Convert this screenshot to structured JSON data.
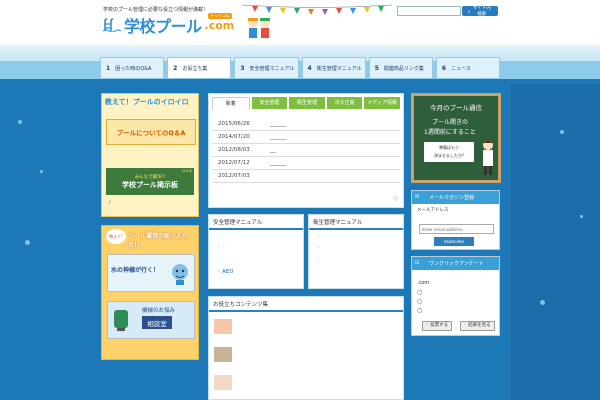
{
  "header": {
    "tagline": "学校のプール管理に必要な役立つ情報が満載！",
    "logo_main": "学校プール",
    "logo_com": ".com",
    "logo_furigana": "ドットコム",
    "search_placeholder": "",
    "search_button": "サイト内検索"
  },
  "nav": {
    "tabs": [
      {
        "num": "1",
        "label": "困った時のQ&A"
      },
      {
        "num": "2",
        "label": "お役立ち集"
      },
      {
        "num": "3",
        "label": "安全管理マニュアル"
      },
      {
        "num": "4",
        "label": "衛生管理マニュアル"
      },
      {
        "num": "5",
        "label": "関連商品リンク集"
      },
      {
        "num": "6",
        "label": "ニュース"
      }
    ]
  },
  "left": {
    "banner_title": "教えて！プールのイロイロ",
    "qa_label": "プールについてのQ＆A",
    "bbs_top": "みんなで解決!!",
    "bbs_badge": "CLICK",
    "bbs_label": "学校プール掲示板",
    "bbs_note": "♪",
    "ops_title": "プール運営の助っ人たち!!",
    "ops_badge": "教えて!",
    "ops_item1": "水の神様が行く！",
    "ops_item2_top": "機械のお悩み",
    "ops_item2": "相談室"
  },
  "news": {
    "tabs": [
      "新着",
      "安全管理",
      "衛生管理",
      "法令正冊",
      "メディア情報"
    ],
    "rows": [
      {
        "date": "2015/06/26",
        "text": "______"
      },
      {
        "date": "2014/07/20",
        "text": "______"
      },
      {
        "date": "2012/08/03",
        "text": "__"
      },
      {
        "date": "2012/07/12",
        "text": "______"
      },
      {
        "date": "2012/07/03",
        "text": ""
      }
    ]
  },
  "manuals": {
    "safety_title": "安全管理マニュアル",
    "safety_items": [
      "",
      "",
      ""
    ],
    "safety_aed": "AED",
    "hygiene_title": "衛生管理マニュアル",
    "hygiene_items": [
      "",
      "",
      ""
    ]
  },
  "contents": {
    "title": "お役立ちコンテンツ集",
    "items": [
      "",
      "",
      ""
    ]
  },
  "right": {
    "monthly_title": "今月のプール通信",
    "monthly_line1": "プール開きの",
    "monthly_line2": "1週間前にすること",
    "monthly_sub1": "準備はもう",
    "monthly_sub2": "済ませましたか?",
    "mag_title": "メールマガジン登録",
    "mag_label": "メールアドレス",
    "mag_placeholder": "Enter email address...",
    "mag_button": "Subscribe",
    "poll_title": "ワンクリックアンケート",
    "poll_domain": ".com",
    "poll_vote": "投票する",
    "poll_results": "結果を見る"
  },
  "colors": {
    "water": "#1d78b8",
    "accent_blue": "#2f8fd2",
    "accent_green": "#7fbf3f",
    "accent_orange": "#f39c12"
  }
}
